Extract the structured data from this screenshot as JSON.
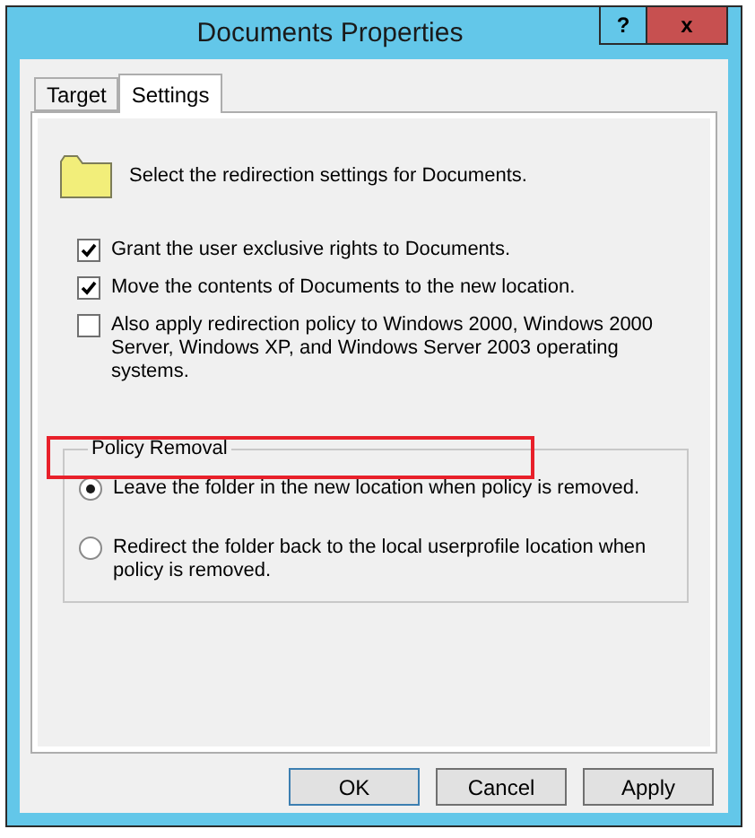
{
  "window": {
    "title": "Documents Properties",
    "help_button": "?",
    "close_button": "x"
  },
  "tabs": [
    {
      "label": "Target",
      "selected": false
    },
    {
      "label": "Settings",
      "selected": true
    }
  ],
  "intro": "Select the redirection settings for Documents.",
  "options": [
    {
      "label": "Grant the user exclusive rights to Documents.",
      "checked": true
    },
    {
      "label": "Move the contents of Documents to the new location.",
      "checked": true
    },
    {
      "label": "Also apply redirection policy to Windows 2000, Windows 2000 Server, Windows XP, and Windows Server 2003 operating systems.",
      "checked": false
    }
  ],
  "policy_removal": {
    "title": "Policy Removal",
    "highlighted": true,
    "choices": [
      {
        "label": "Leave the folder in the new location when policy is removed.",
        "selected": true
      },
      {
        "label": "Redirect the folder back to the local userprofile location when policy is removed.",
        "selected": false
      }
    ]
  },
  "buttons": [
    {
      "label": "OK",
      "default": true
    },
    {
      "label": "Cancel",
      "default": false
    },
    {
      "label": "Apply",
      "default": false
    }
  ]
}
